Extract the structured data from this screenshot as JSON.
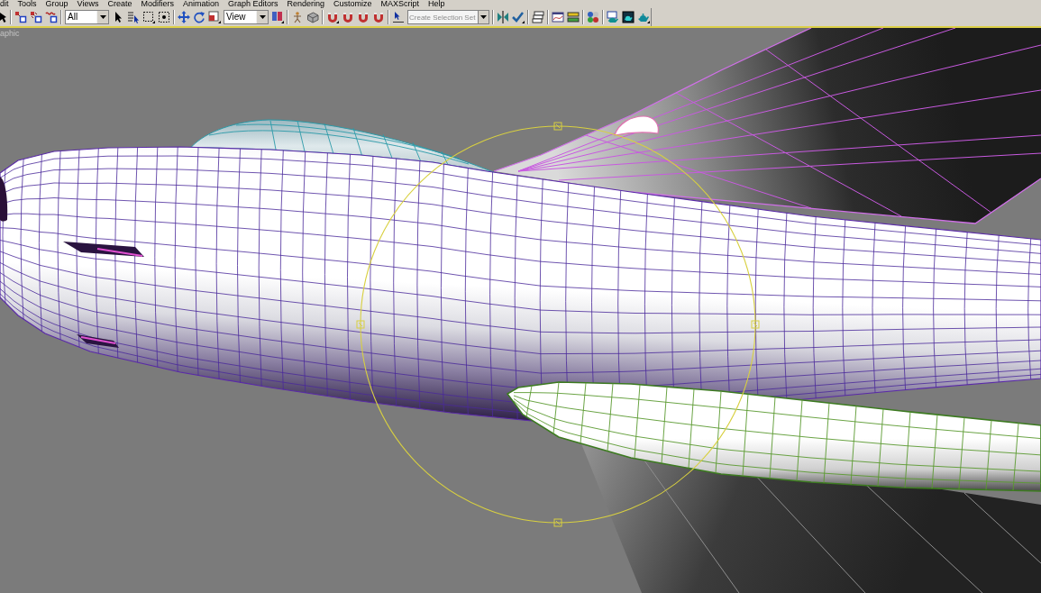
{
  "menu_bar": {
    "items": [
      "dit",
      "Tools",
      "Group",
      "Views",
      "Create",
      "Modifiers",
      "Animation",
      "Graph Editors",
      "Rendering",
      "Customize",
      "MAXScript",
      "Help"
    ]
  },
  "toolbar": {
    "selection_filter": {
      "value": "All"
    },
    "reference_coordinate_system": {
      "value": "View"
    },
    "named_selection_set": {
      "placeholder": "Create Selection Set"
    }
  },
  "viewport": {
    "label": "aphic"
  }
}
